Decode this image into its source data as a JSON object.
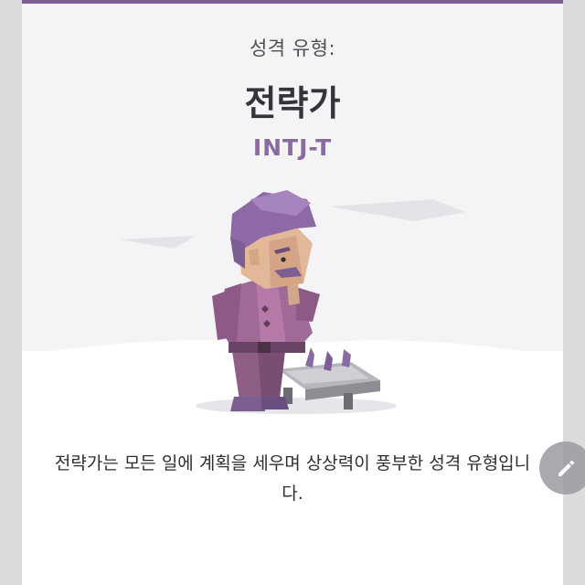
{
  "personality": {
    "prefix": "성격 유형:",
    "title": "전략가",
    "code": "INTJ-T",
    "description": "전략가는 모든 일에 계획을 세우며 상상력이 풍부한 성격 유형입니다."
  },
  "colors": {
    "accent": "#7c5e93",
    "code_text": "#8a6aa2",
    "card_background": "#f4f4f6",
    "page_background": "#dcdcde"
  },
  "icons": {
    "illustration": "strategist-character-illustration",
    "fab": "pencil-icon"
  }
}
